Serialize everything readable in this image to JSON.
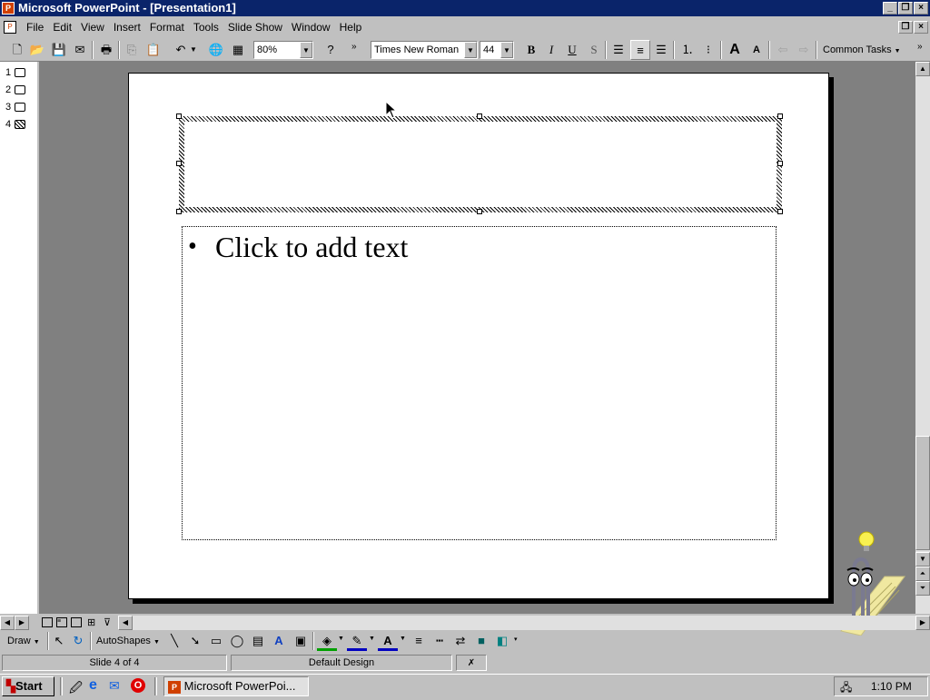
{
  "window": {
    "title": "Microsoft PowerPoint - [Presentation1]"
  },
  "menu": [
    "File",
    "Edit",
    "View",
    "Insert",
    "Format",
    "Tools",
    "Slide Show",
    "Window",
    "Help"
  ],
  "toolbar": {
    "zoom": "80%",
    "font": "Times New Roman",
    "font_size": "44",
    "common_tasks": "Common Tasks",
    "bold": "B",
    "italic": "I",
    "underline": "U",
    "shadow": "S"
  },
  "outline": {
    "slides": [
      "1",
      "2",
      "3",
      "4"
    ]
  },
  "slide": {
    "body_bullet": "•",
    "body_text": "Click to add text"
  },
  "drawing": {
    "draw_label": "Draw",
    "autoshapes_label": "AutoShapes"
  },
  "status": {
    "slide_position": "Slide 4 of 4",
    "design": "Default Design"
  },
  "taskbar": {
    "start": "Start",
    "task_label": "Microsoft PowerPoi...",
    "clock": "1:10 PM"
  },
  "colors": {
    "titlebar": "#0a246a",
    "face": "#c0c0c0",
    "workspace": "#808080",
    "slide": "#ffffff"
  }
}
